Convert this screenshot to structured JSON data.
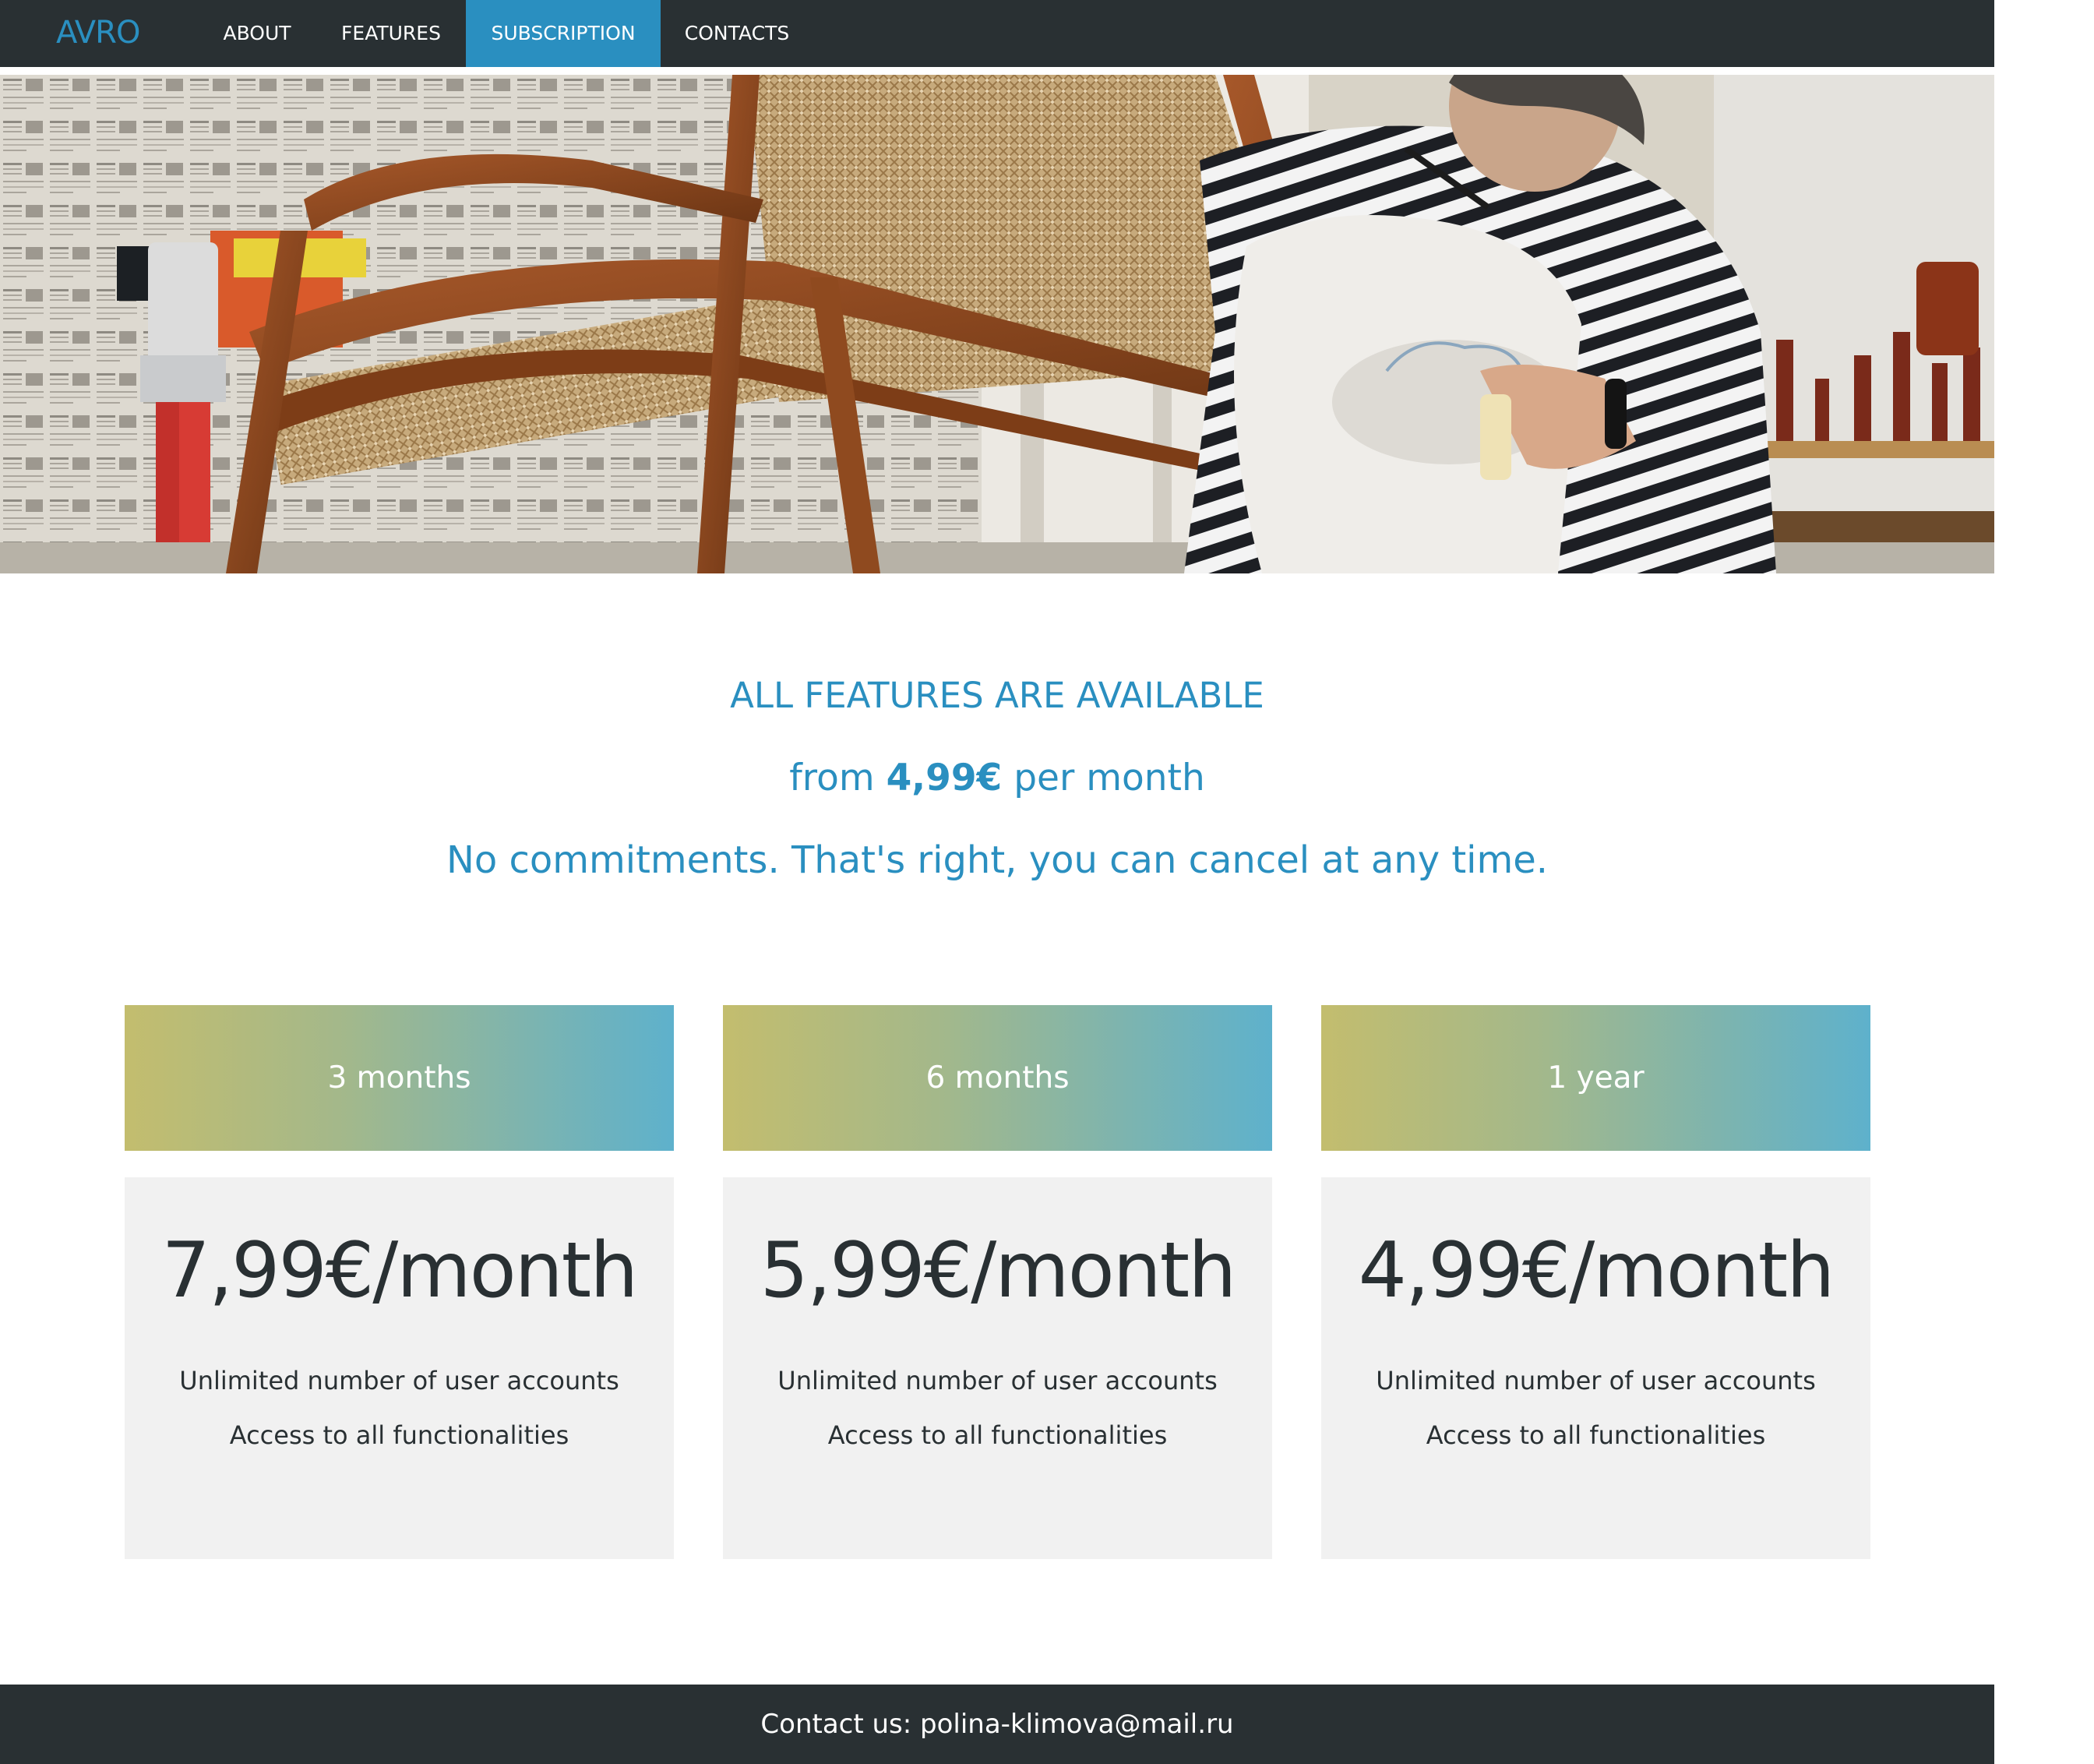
{
  "navbar": {
    "logo": "AVRO",
    "items": [
      {
        "label": "ABOUT"
      },
      {
        "label": "FEATURES"
      },
      {
        "label": "SUBSCRIPTION",
        "active": true
      },
      {
        "label": "CONTACTS"
      }
    ]
  },
  "hero": {
    "image_description": "Craftsperson in a striped shirt and apron restoring a wooden cane chair in a workshop"
  },
  "intro": {
    "headline": "ALL FEATURES ARE AVAILABLE",
    "from_prefix": "from ",
    "from_price": "4,99€",
    "from_suffix": " per month",
    "cancel_text": "No commitments. That's right, you can cancel at any time."
  },
  "plans": [
    {
      "name": "3 months",
      "price": "7,99€/month",
      "features": [
        "Unlimited number of user accounts",
        "Access to all functionalities"
      ]
    },
    {
      "name": "6 months",
      "price": "5,99€/month",
      "features": [
        "Unlimited number of user accounts",
        "Access to all functionalities"
      ]
    },
    {
      "name": "1 year",
      "price": "4,99€/month",
      "features": [
        "Unlimited number of user accounts",
        "Access to all functionalities"
      ]
    }
  ],
  "footer": {
    "contact_text": "Contact us: polina-klimova@mail.ru"
  },
  "colors": {
    "accent": "#2a8fc0",
    "navbar_bg": "#293033",
    "card_bg": "#f1f1f1",
    "gradient_start": "#c3bd6e",
    "gradient_end": "#5eb1cc"
  }
}
